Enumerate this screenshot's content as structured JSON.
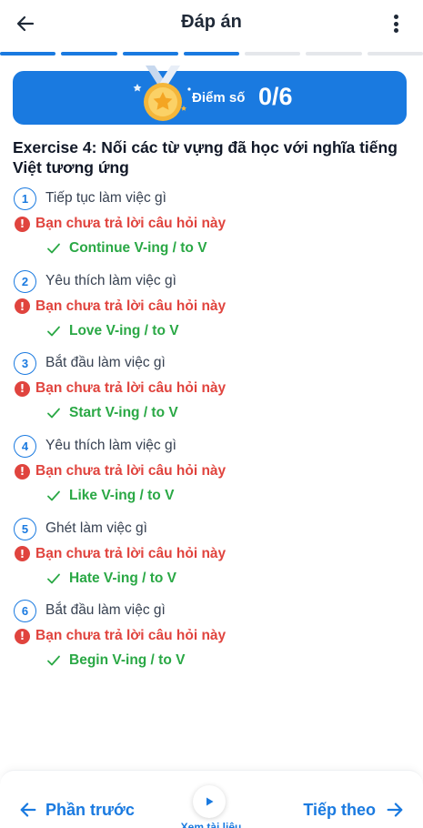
{
  "header": {
    "title": "Đáp án"
  },
  "progress": {
    "segments_total": 7,
    "segments_completed": 4
  },
  "score": {
    "label": "Điểm số",
    "value": "0/6"
  },
  "exercise": {
    "title": "Exercise 4: Nối các từ vựng đã học với nghĩa tiếng Việt tương ứng"
  },
  "questions": [
    {
      "number": "1",
      "prompt": "Tiếp tục làm việc gì",
      "status": "Bạn chưa trả lời câu hỏi này",
      "answer": "Continue V-ing / to V"
    },
    {
      "number": "2",
      "prompt": "Yêu thích làm việc gì",
      "status": "Bạn chưa trả lời câu hỏi này",
      "answer": "Love V-ing / to V"
    },
    {
      "number": "3",
      "prompt": "Bắt đầu làm việc gì",
      "status": "Bạn chưa trả lời câu hỏi này",
      "answer": "Start V-ing / to V"
    },
    {
      "number": "4",
      "prompt": "Yêu thích làm việc gì",
      "status": "Bạn chưa trả lời câu hỏi này",
      "answer": "Like V-ing / to V"
    },
    {
      "number": "5",
      "prompt": "Ghét làm việc gì",
      "status": "Bạn chưa trả lời câu hỏi này",
      "answer": "Hate V-ing / to V"
    },
    {
      "number": "6",
      "prompt": "Bắt đầu làm việc gì",
      "status": "Bạn chưa trả lời câu hỏi này",
      "answer": "Begin V-ing / to V"
    }
  ],
  "bottom_nav": {
    "prev_label": "Phần trước",
    "next_label": "Tiếp theo",
    "docs_label": "Xem tài liệu"
  },
  "colors": {
    "primary": "#1a7ae0",
    "error": "#e0443e",
    "success": "#2aa845",
    "medal_gold": "#f4b63a"
  },
  "icons": {
    "back": "arrow-left-icon",
    "more": "more-vertical-icon",
    "medal": "medal-icon",
    "error": "exclamation-circle-icon",
    "check": "check-icon",
    "prev": "arrow-left-icon",
    "next": "arrow-right-icon",
    "play": "play-icon"
  }
}
